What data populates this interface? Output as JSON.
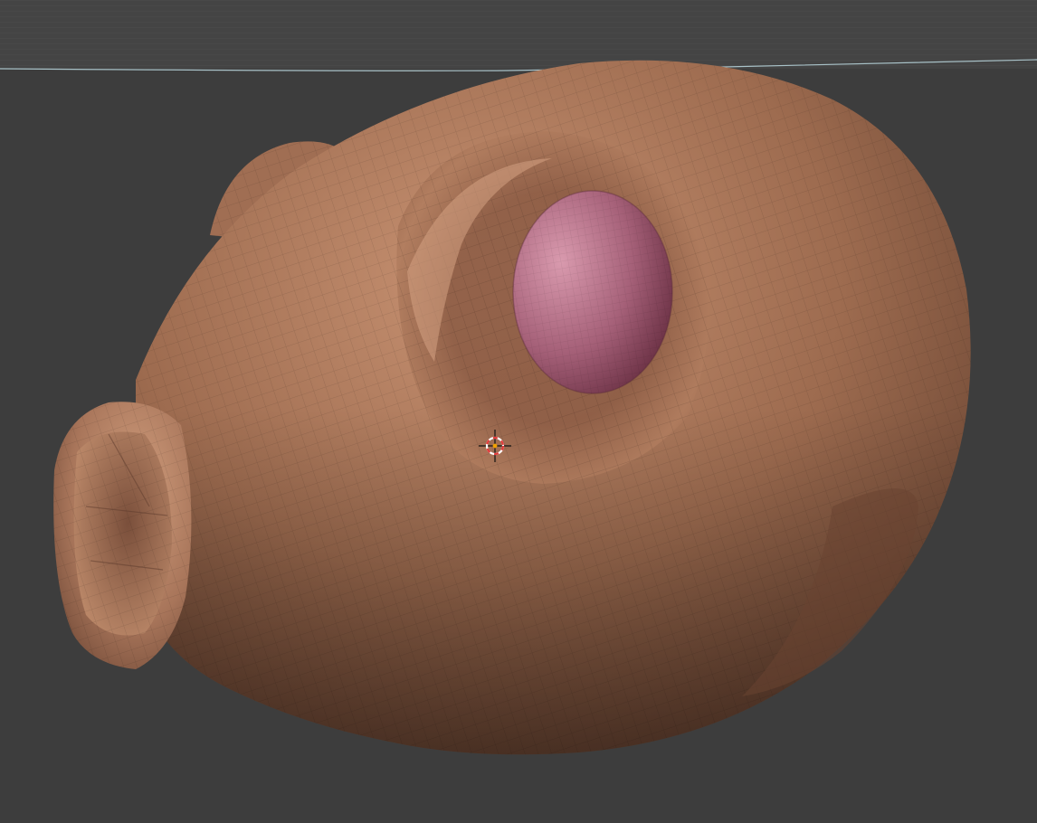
{
  "viewport": {
    "background_color": "#3d3d3d",
    "top_band_color": "#444444",
    "horizon_line_color": "#a9c2c8",
    "grid_visible": true
  },
  "scene_object": {
    "kind": "sculpted-head-mesh",
    "shading": "solid-with-wireframe",
    "material_colors": {
      "skin_light": "#c99373",
      "skin_mid": "#9d6b4f",
      "skin_dark": "#5e3c2c",
      "eye_light": "#d99aae",
      "eye_mid": "#a56078",
      "eye_dark": "#6f3448"
    }
  },
  "cursor_3d": {
    "icon": "3d-cursor-icon",
    "ring_color_a": "#e33b3b",
    "ring_color_b": "#ffffff",
    "crosshair_color": "#111111",
    "center_color": "#f0a000"
  }
}
